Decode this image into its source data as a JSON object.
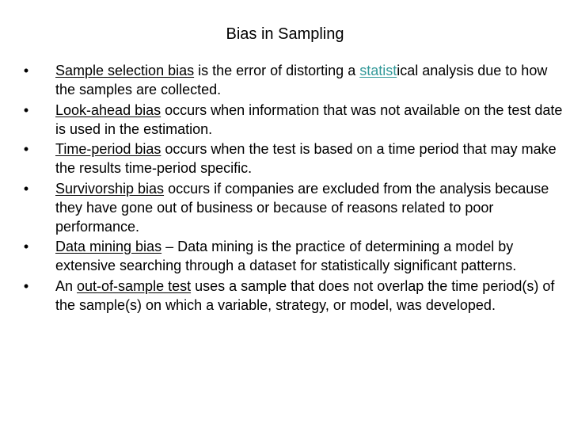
{
  "slide": {
    "title": "Bias in Sampling",
    "accent_color": "#339999",
    "bullets": [
      {
        "prefix": "",
        "term": "Sample selection bias",
        "text_before_link": " is the error of distorting a ",
        "link_fragment": "statist",
        "text_after_link": "ical analysis due to  how the samples are collected."
      },
      {
        "prefix": "",
        "term": "Look-ahead bias",
        "text": " occurs when information that was not available on the test date is used in the estimation."
      },
      {
        "prefix": "",
        "term": "Time-period bias",
        "text": " occurs when the test is based on a time period that may make the results time-period specific."
      },
      {
        "prefix": "",
        "term": "Survivorship bias",
        "text": " occurs if companies are excluded from the analysis because they have gone out of business or because of reasons related to poor performance."
      },
      {
        "prefix": "",
        "term": "Data mining bias",
        "text": " – Data mining is the practice of determining a model by extensive searching through a dataset for statistically significant patterns."
      },
      {
        "prefix": "An ",
        "term": "out-of-sample test",
        "text": " uses a sample that does not overlap the time period(s) of the sample(s) on which a variable, strategy, or model, was developed."
      }
    ],
    "bullet_glyph": "•"
  }
}
